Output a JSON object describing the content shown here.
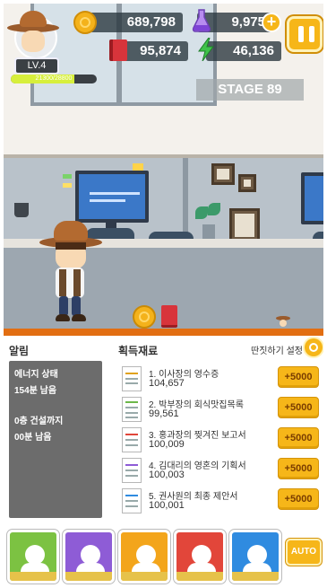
{
  "hud": {
    "gold": "689,798",
    "flask": "9,975",
    "books": "95,874",
    "energy": "46,136",
    "level": "LV.4",
    "exp_text": "21300/28800",
    "exp_fraction": 0.74,
    "stage": "STAGE 89"
  },
  "panel": {
    "notice_title": "알림",
    "materials_title": "획득재료",
    "settings_label": "딴짓하기 설정",
    "notice": {
      "energy_label": "에너지 상태",
      "energy_value": "154분 남음",
      "build_label": "0층 건설까지",
      "build_value": "00분 남음"
    },
    "materials": [
      {
        "name": "1. 이사장의 영수증",
        "count": "104,657",
        "button": "+5000"
      },
      {
        "name": "2. 박부장의 회식맛집목록",
        "count": "99,561",
        "button": "+5000"
      },
      {
        "name": "3. 홍과장의 찢겨진 보고서",
        "count": "100,009",
        "button": "+5000"
      },
      {
        "name": "4. 김대리의 영혼의 기획서",
        "count": "100,003",
        "button": "+5000"
      },
      {
        "name": "5. 권사원의 최종 제안서",
        "count": "100,001",
        "button": "+5000"
      }
    ],
    "auto_label": "AUTO"
  },
  "skills": [
    {
      "icon": "skill-stretch-icon",
      "color": "#7cc242"
    },
    {
      "icon": "skill-paperwork-icon",
      "color": "#8e5cd6"
    },
    {
      "icon": "skill-cheer-icon",
      "color": "#f3a51b"
    },
    {
      "icon": "skill-rage-icon",
      "color": "#e2463a"
    },
    {
      "icon": "skill-focus-icon",
      "color": "#2f8be0"
    }
  ],
  "colors": {
    "accent": "#f6b619",
    "floor_stripe": "#e26e12"
  }
}
